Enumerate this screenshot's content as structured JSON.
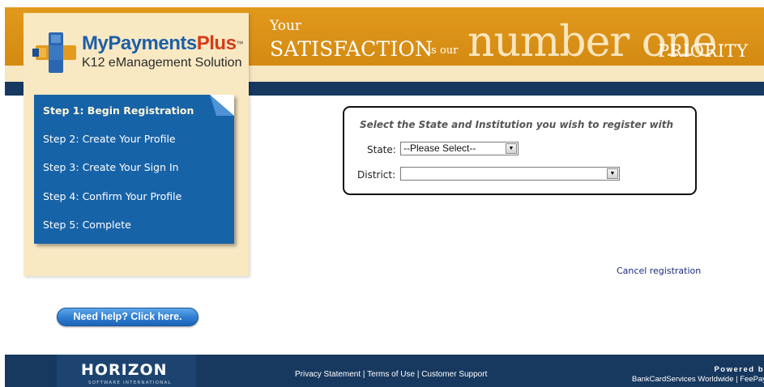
{
  "header": {
    "slogan_your": "Your",
    "slogan_satisfaction": "SATISFACTION",
    "slogan_is_our": "is our",
    "slogan_number_one": "number one",
    "slogan_priority": "PRIORITY",
    "brand_color": "#d48a12",
    "navy_color": "#17385f"
  },
  "logo": {
    "name_part1": "MyPayments",
    "name_part2": "Plus",
    "trademark": "™",
    "tagline": "K12 eManagement Solution"
  },
  "steps": [
    {
      "label": "Step 1: Begin Registration",
      "active": true
    },
    {
      "label": "Step 2: Create Your Profile",
      "active": false
    },
    {
      "label": "Step 3: Create Your Sign In",
      "active": false
    },
    {
      "label": "Step 4: Confirm Your Profile",
      "active": false
    },
    {
      "label": "Step 5: Complete",
      "active": false
    }
  ],
  "help_button": {
    "label": "Need help? Click here."
  },
  "registration": {
    "title": "Select the State and Institution you wish to register with",
    "state_label": "State:",
    "state_value": "--Please Select--",
    "district_label": "District:",
    "district_value": ""
  },
  "cancel_link": "Cancel registration",
  "footer": {
    "logo_text": "HORIZON",
    "logo_subtext": "SOFTWARE INTERNATIONAL",
    "links": [
      "Privacy Statement",
      "Terms of Use",
      "Customer Support"
    ],
    "separator": " | ",
    "powered_by": "Powered b",
    "partners": "BankCardServices Worldwide | FeePay"
  }
}
